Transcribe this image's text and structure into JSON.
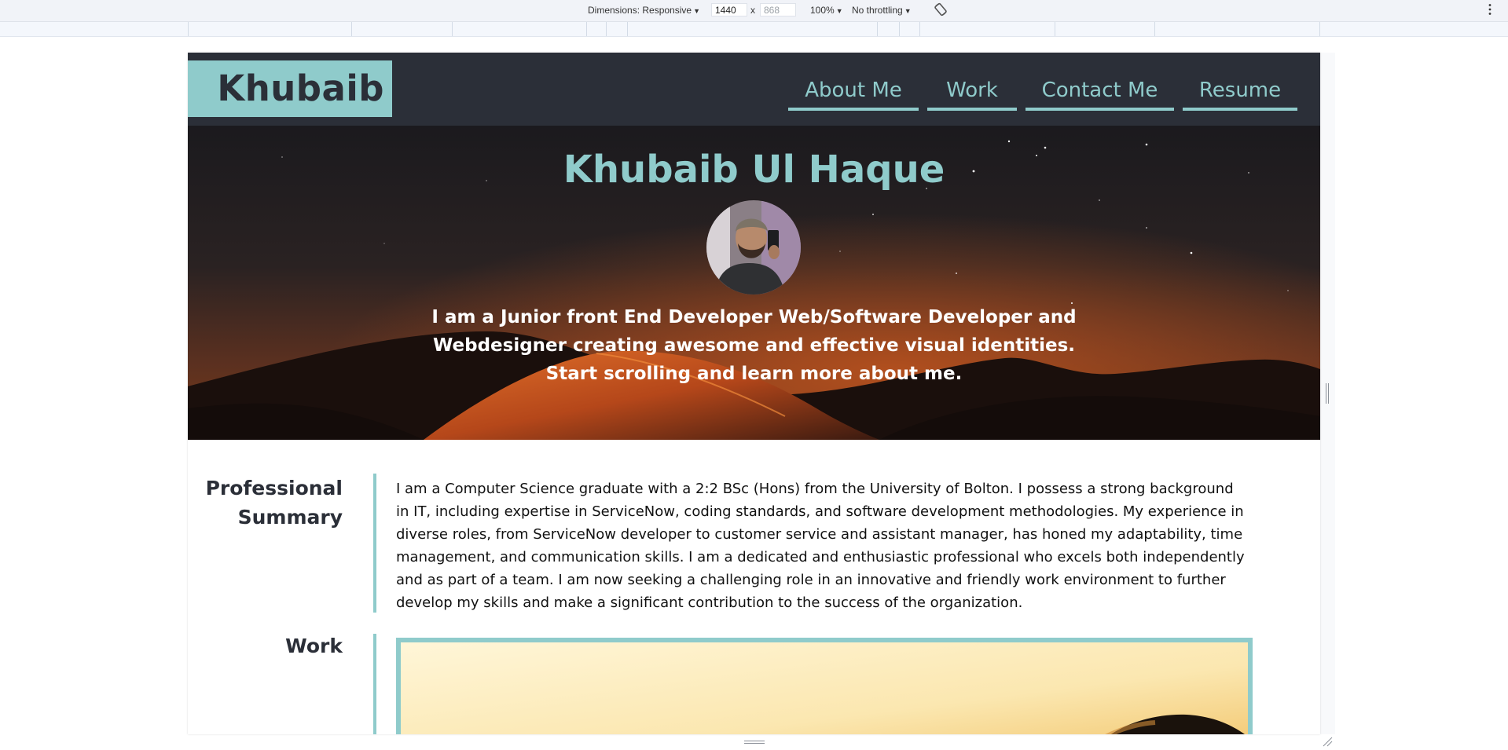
{
  "devtools": {
    "dimensions_label": "Dimensions: Responsive",
    "width_value": "1440",
    "times_sign": "x",
    "height_value": "868",
    "zoom_label": "100%",
    "throttling_label": "No throttling"
  },
  "site": {
    "logo": "Khubaib",
    "nav": [
      "About Me",
      "Work",
      "Contact Me",
      "Resume"
    ],
    "hero": {
      "title": "Khubaib Ul Haque",
      "tagline": "I am a Junior front End Developer Web/Software Developer and Webdesigner creating awesome and effective visual identities. Start scrolling and learn more about me."
    },
    "summary": {
      "heading": "Professional Summary",
      "text": "I am a Computer Science graduate with a 2:2 BSc (Hons) from the University of Bolton. I possess a strong background in IT, including expertise in ServiceNow, coding standards, and software development methodologies. My experience in diverse roles, from ServiceNow developer to customer service and assistant manager, has honed my adaptability, time management, and communication skills. I am a dedicated and enthusiastic professional who excels both independently and as part of a team. I am now seeking a challenging role in an innovative and friendly work environment to further develop my skills and make a significant contribution to the success of the organization."
    },
    "work": {
      "heading": "Work"
    }
  },
  "colors": {
    "header_bg": "#2b2f38",
    "accent": "#8fcbcb",
    "devtools_bg": "#f1f3f8",
    "hero_dune": "#c8561f"
  },
  "icons": [
    "caret-down-icon",
    "rotate-icon",
    "more-options-icon",
    "resize-handle-icon"
  ]
}
